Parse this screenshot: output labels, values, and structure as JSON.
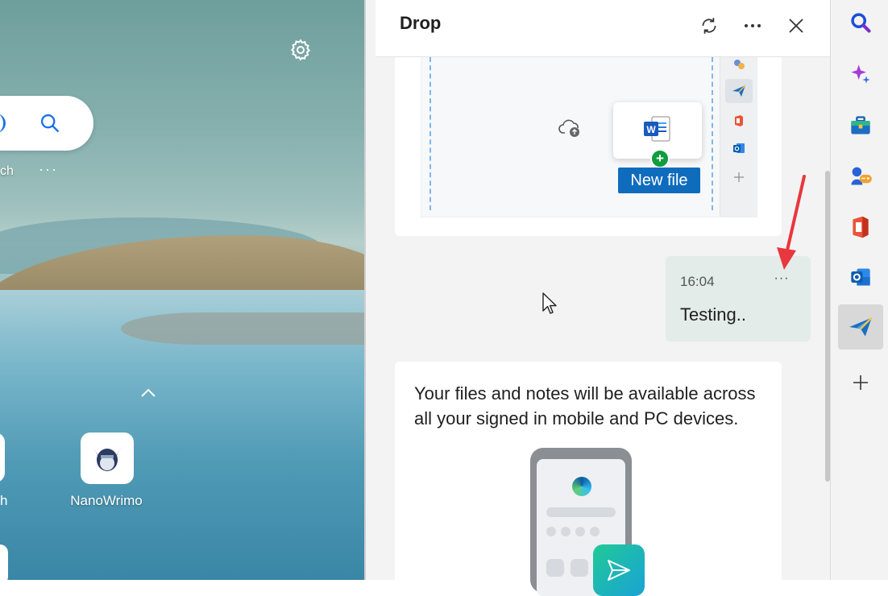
{
  "new_tab": {
    "search_label_partial": "ch",
    "more_glyph": "···",
    "tiles": [
      {
        "label_partial": "h"
      },
      {
        "label": "NanoWrimo"
      }
    ]
  },
  "drop": {
    "title": "Drop",
    "header_buttons": [
      "sync-icon",
      "more-icon",
      "close-icon"
    ],
    "preview": {
      "new_file_label": "New file",
      "plus_badge": "+"
    },
    "message": {
      "time": "16:04",
      "more_glyph": "···",
      "text": "Testing.."
    },
    "info": {
      "text": "Your files and notes will be available across all your signed in mobile and PC devices."
    }
  },
  "sidebar": {
    "items": [
      "search-icon",
      "copilot-icon",
      "tools-icon",
      "games-icon",
      "office-icon",
      "outlook-icon",
      "drop-icon",
      "add-icon"
    ],
    "active": "drop-icon"
  },
  "colors": {
    "accent_blue": "#0f6cbd",
    "message_bg": "#e3ece8",
    "annotation_red": "#e8373d"
  }
}
